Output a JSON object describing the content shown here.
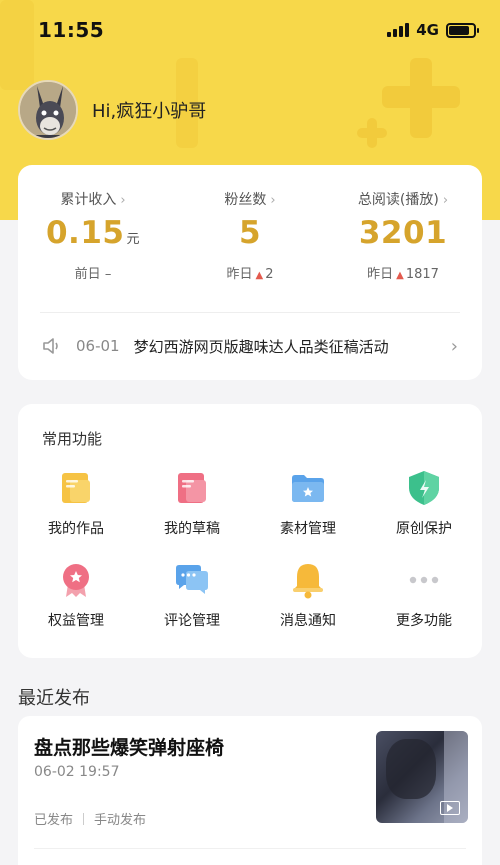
{
  "status_bar": {
    "time": "11:55",
    "network": "4G"
  },
  "profile": {
    "greeting": "Hi,疯狂小驴哥"
  },
  "stats": [
    {
      "label": "累计收入",
      "value": "0.15",
      "unit": "元",
      "sub_label": "前日",
      "sub_value": "–",
      "trend": ""
    },
    {
      "label": "粉丝数",
      "value": "5",
      "unit": "",
      "sub_label": "昨日",
      "sub_value": "2",
      "trend": "up"
    },
    {
      "label": "总阅读(播放)",
      "value": "3201",
      "unit": "",
      "sub_label": "昨日",
      "sub_value": "1817",
      "trend": "up"
    }
  ],
  "notice": {
    "date": "06-01",
    "title": "梦幻西游网页版趣味达人品类征稿活动"
  },
  "functions": {
    "title": "常用功能",
    "items": [
      {
        "label": "我的作品",
        "icon": "works-icon"
      },
      {
        "label": "我的草稿",
        "icon": "drafts-icon"
      },
      {
        "label": "素材管理",
        "icon": "folder-icon"
      },
      {
        "label": "原创保护",
        "icon": "shield-icon"
      },
      {
        "label": "权益管理",
        "icon": "badge-icon"
      },
      {
        "label": "评论管理",
        "icon": "comment-icon"
      },
      {
        "label": "消息通知",
        "icon": "bell-icon"
      },
      {
        "label": "更多功能",
        "icon": "more-icon"
      }
    ]
  },
  "recent": {
    "title": "最近发布",
    "article": {
      "title": "盘点那些爆笑弹射座椅",
      "time": "06-02 19:57",
      "status": "已发布",
      "mode": "手动发布"
    }
  },
  "colors": {
    "brand_yellow": "#f7d84a",
    "accent_gold": "#d6a42c",
    "trend_red": "#e35a4e"
  }
}
